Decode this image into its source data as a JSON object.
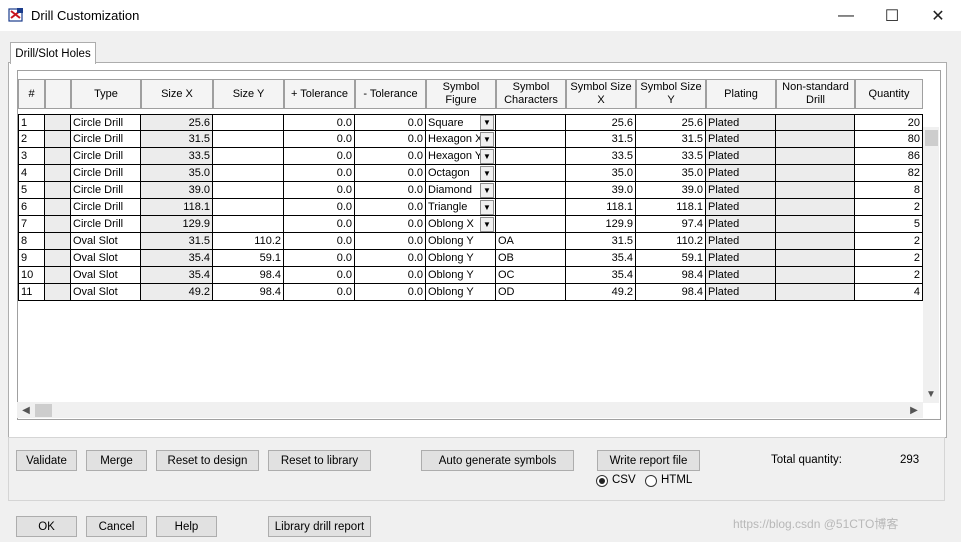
{
  "window": {
    "title": "Drill Customization",
    "min": "—",
    "max": "☐",
    "close": "✕"
  },
  "tabs": [
    {
      "label": "Drill/Slot Holes"
    }
  ],
  "columns": [
    "#",
    "",
    "Type",
    "Size X",
    "Size Y",
    "+ Tolerance",
    "- Tolerance",
    "Symbol Figure",
    "Symbol Characters",
    "Symbol Size X",
    "Symbol Size Y",
    "Plating",
    "Non-standard Drill",
    "Quantity"
  ],
  "rows": [
    [
      "1",
      "",
      "Circle Drill",
      "25.6",
      "",
      "0.0",
      "0.0",
      "Square",
      "",
      "25.6",
      "25.6",
      "Plated",
      "",
      "20"
    ],
    [
      "2",
      "",
      "Circle Drill",
      "31.5",
      "",
      "0.0",
      "0.0",
      "Hexagon X",
      "",
      "31.5",
      "31.5",
      "Plated",
      "",
      "80"
    ],
    [
      "3",
      "",
      "Circle Drill",
      "33.5",
      "",
      "0.0",
      "0.0",
      "Hexagon Y",
      "",
      "33.5",
      "33.5",
      "Plated",
      "",
      "86"
    ],
    [
      "4",
      "",
      "Circle Drill",
      "35.0",
      "",
      "0.0",
      "0.0",
      "Octagon",
      "",
      "35.0",
      "35.0",
      "Plated",
      "",
      "82"
    ],
    [
      "5",
      "",
      "Circle Drill",
      "39.0",
      "",
      "0.0",
      "0.0",
      "Diamond",
      "",
      "39.0",
      "39.0",
      "Plated",
      "",
      "8"
    ],
    [
      "6",
      "",
      "Circle Drill",
      "118.1",
      "",
      "0.0",
      "0.0",
      "Triangle",
      "",
      "118.1",
      "118.1",
      "Plated",
      "",
      "2"
    ],
    [
      "7",
      "",
      "Circle Drill",
      "129.9",
      "",
      "0.0",
      "0.0",
      "Oblong X",
      "",
      "129.9",
      "97.4",
      "Plated",
      "",
      "5"
    ],
    [
      "8",
      "",
      "Oval Slot",
      "31.5",
      "110.2",
      "0.0",
      "0.0",
      "Oblong Y",
      "OA",
      "31.5",
      "110.2",
      "Plated",
      "",
      "2"
    ],
    [
      "9",
      "",
      "Oval Slot",
      "35.4",
      "59.1",
      "0.0",
      "0.0",
      "Oblong Y",
      "OB",
      "35.4",
      "59.1",
      "Plated",
      "",
      "2"
    ],
    [
      "10",
      "",
      "Oval Slot",
      "35.4",
      "98.4",
      "0.0",
      "0.0",
      "Oblong Y",
      "OC",
      "35.4",
      "98.4",
      "Plated",
      "",
      "2"
    ],
    [
      "11",
      "",
      "Oval Slot",
      "49.2",
      "98.4",
      "0.0",
      "0.0",
      "Oblong Y",
      "OD",
      "49.2",
      "98.4",
      "Plated",
      "",
      "4"
    ]
  ],
  "combo_rows": 7,
  "buttons": {
    "validate": "Validate",
    "merge": "Merge",
    "reset_design": "Reset to design",
    "reset_library": "Reset to library",
    "auto_generate": "Auto generate symbols",
    "write_report": "Write report file",
    "ok": "OK",
    "cancel": "Cancel",
    "help": "Help",
    "library_report": "Library drill report"
  },
  "report_format": {
    "options": [
      "CSV",
      "HTML"
    ],
    "selected": "CSV"
  },
  "total": {
    "label": "Total quantity:",
    "value": "293"
  },
  "watermark": "https://blog.csdn @51CTO博客"
}
